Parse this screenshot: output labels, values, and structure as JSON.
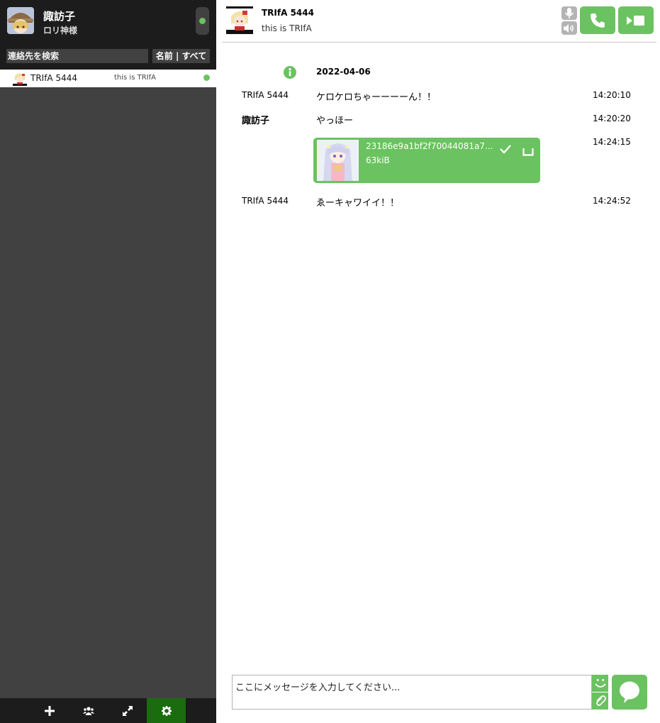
{
  "self": {
    "name": "諏訪子",
    "status_message": "ロリ神様",
    "status_color": "#6bc260"
  },
  "search": {
    "placeholder": "連絡先を検索",
    "filter_label": "名前 | すべて"
  },
  "contacts": [
    {
      "name": "TRIfA 5444",
      "status_message": "this is TRIfA",
      "online_color": "#6bc260"
    }
  ],
  "bottom_bar": {
    "items": [
      {
        "icon": "add-icon"
      },
      {
        "icon": "group-icon"
      },
      {
        "icon": "file-transfer-icon"
      },
      {
        "icon": "settings-icon",
        "active": true
      }
    ]
  },
  "chat_header": {
    "name": "TRIfA 5444",
    "status_message": "this is TRIfA",
    "buttons": [
      "microphone-icon",
      "volume-icon",
      "phone-icon",
      "video-icon"
    ]
  },
  "messages": {
    "date": "2022-04-06",
    "items": [
      {
        "author": "TRIfA 5444",
        "text": "ケロケロちゃーーーーん！！",
        "time": "14:20:10"
      },
      {
        "author": "諏訪子",
        "text": "やっほー",
        "time": "14:20:20"
      },
      {
        "author": "",
        "file": {
          "name": "23186e9a1bf2f70044081a7...",
          "size": "63kiB"
        },
        "time": "14:24:15"
      },
      {
        "author": "TRIfA 5444",
        "text": "ゑーキャワイイ！！",
        "time": "14:24:52"
      }
    ]
  },
  "input": {
    "placeholder": "ここにメッセージを入力してください..."
  },
  "colors": {
    "accent": "#6bc260",
    "sidebar_bg": "#414141",
    "panel_dark": "#1c1c1c",
    "active_tab": "#1b6b0f"
  }
}
